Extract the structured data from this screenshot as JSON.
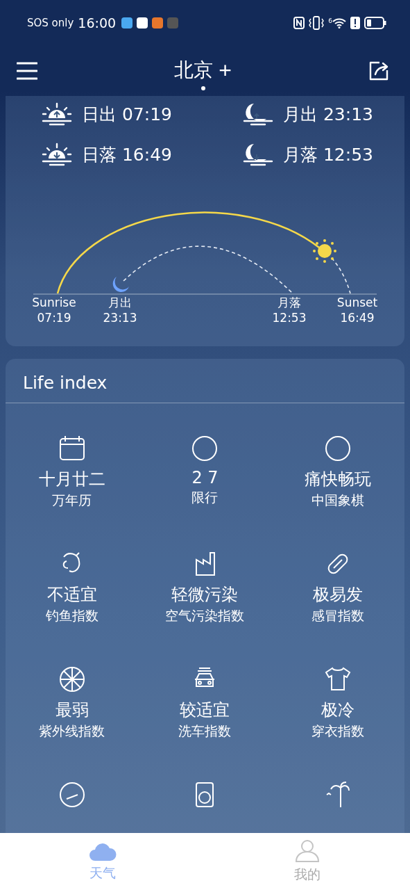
{
  "status_bar": {
    "carrier": "SOS only",
    "time": "16:00",
    "wifi_label": "6"
  },
  "header": {
    "city": "北京",
    "add": "+",
    "pages": [
      {
        "selected": true
      }
    ]
  },
  "sun_moon": {
    "times": [
      {
        "kind": "sunrise",
        "label": "日出 07:19"
      },
      {
        "kind": "moonrise",
        "label": "月出 23:13"
      },
      {
        "kind": "sunset",
        "label": "日落 16:49"
      },
      {
        "kind": "moonset",
        "label": "月落 12:53"
      }
    ],
    "arc_labels": [
      {
        "name": "Sunrise",
        "time": "07:19"
      },
      {
        "name": "月出",
        "time": "23:13"
      },
      {
        "name": "月落",
        "time": "12:53"
      },
      {
        "name": "Sunset",
        "time": "16:49"
      }
    ]
  },
  "life_index": {
    "title": "Life index",
    "items": [
      {
        "value": "十月廿二",
        "label": "万年历"
      },
      {
        "value": "2 7",
        "label": "限行"
      },
      {
        "value": "痛快畅玩",
        "label": "中国象棋"
      },
      {
        "value": "不适宜",
        "label": "钓鱼指数"
      },
      {
        "value": "轻微污染",
        "label": "空气污染指数"
      },
      {
        "value": "极易发",
        "label": "感冒指数"
      },
      {
        "value": "最弱",
        "label": "紫外线指数"
      },
      {
        "value": "较适宜",
        "label": "洗车指数"
      },
      {
        "value": "极冷",
        "label": "穿衣指数"
      }
    ]
  },
  "tab_bar": [
    {
      "label": "天气",
      "selected": true
    },
    {
      "label": "我的",
      "selected": false
    }
  ]
}
